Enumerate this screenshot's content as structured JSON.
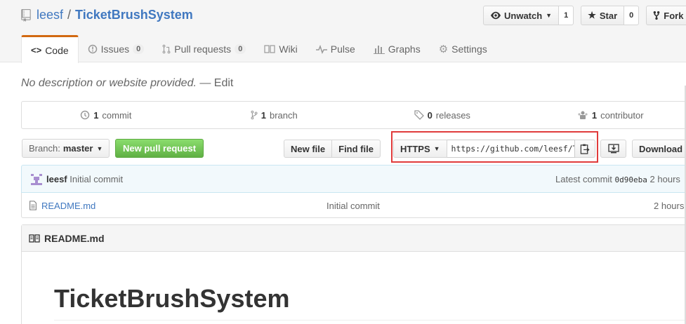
{
  "repo": {
    "owner": "leesf",
    "separator": "/",
    "name": "TicketBrushSystem"
  },
  "actions": {
    "watch_label": "Unwatch",
    "watch_count": "1",
    "star_label": "Star",
    "star_count": "0",
    "fork_label": "Fork"
  },
  "tabs": [
    {
      "label": "Code",
      "icon": "code-icon"
    },
    {
      "label": "Issues",
      "count": "0",
      "icon": "issue-icon"
    },
    {
      "label": "Pull requests",
      "count": "0",
      "icon": "pull-request-icon"
    },
    {
      "label": "Wiki",
      "icon": "book-icon"
    },
    {
      "label": "Pulse",
      "icon": "pulse-icon"
    },
    {
      "label": "Graphs",
      "icon": "graph-icon"
    },
    {
      "label": "Settings",
      "icon": "gear-icon"
    }
  ],
  "description": {
    "text": "No description or website provided.",
    "edit": "— Edit"
  },
  "summary": {
    "commits_num": "1",
    "commits_label": "commit",
    "branches_num": "1",
    "branches_label": "branch",
    "releases_num": "0",
    "releases_label": "releases",
    "contributors_num": "1",
    "contributors_label": "contributor"
  },
  "file_nav": {
    "branch_prefix": "Branch:",
    "branch_name": "master",
    "new_pr": "New pull request",
    "new_file": "New file",
    "find_file": "Find file",
    "protocol": "HTTPS",
    "clone_url": "https://github.com/leesf/TicketBrushSystem.git",
    "download": "Download"
  },
  "last_commit": {
    "author": "leesf",
    "message": "Initial commit",
    "latest_label": "Latest commit",
    "sha": "0d90eba",
    "age": "2 hours"
  },
  "files": [
    {
      "name": "README.md",
      "message": "Initial commit",
      "age": "2 hours"
    }
  ],
  "readme": {
    "filename": "README.md",
    "heading": "TicketBrushSystem"
  },
  "colors": {
    "accent_tab": "#d26911",
    "link": "#4078c0",
    "green_button": "#60b044",
    "highlight_box": "#e03b3b"
  }
}
